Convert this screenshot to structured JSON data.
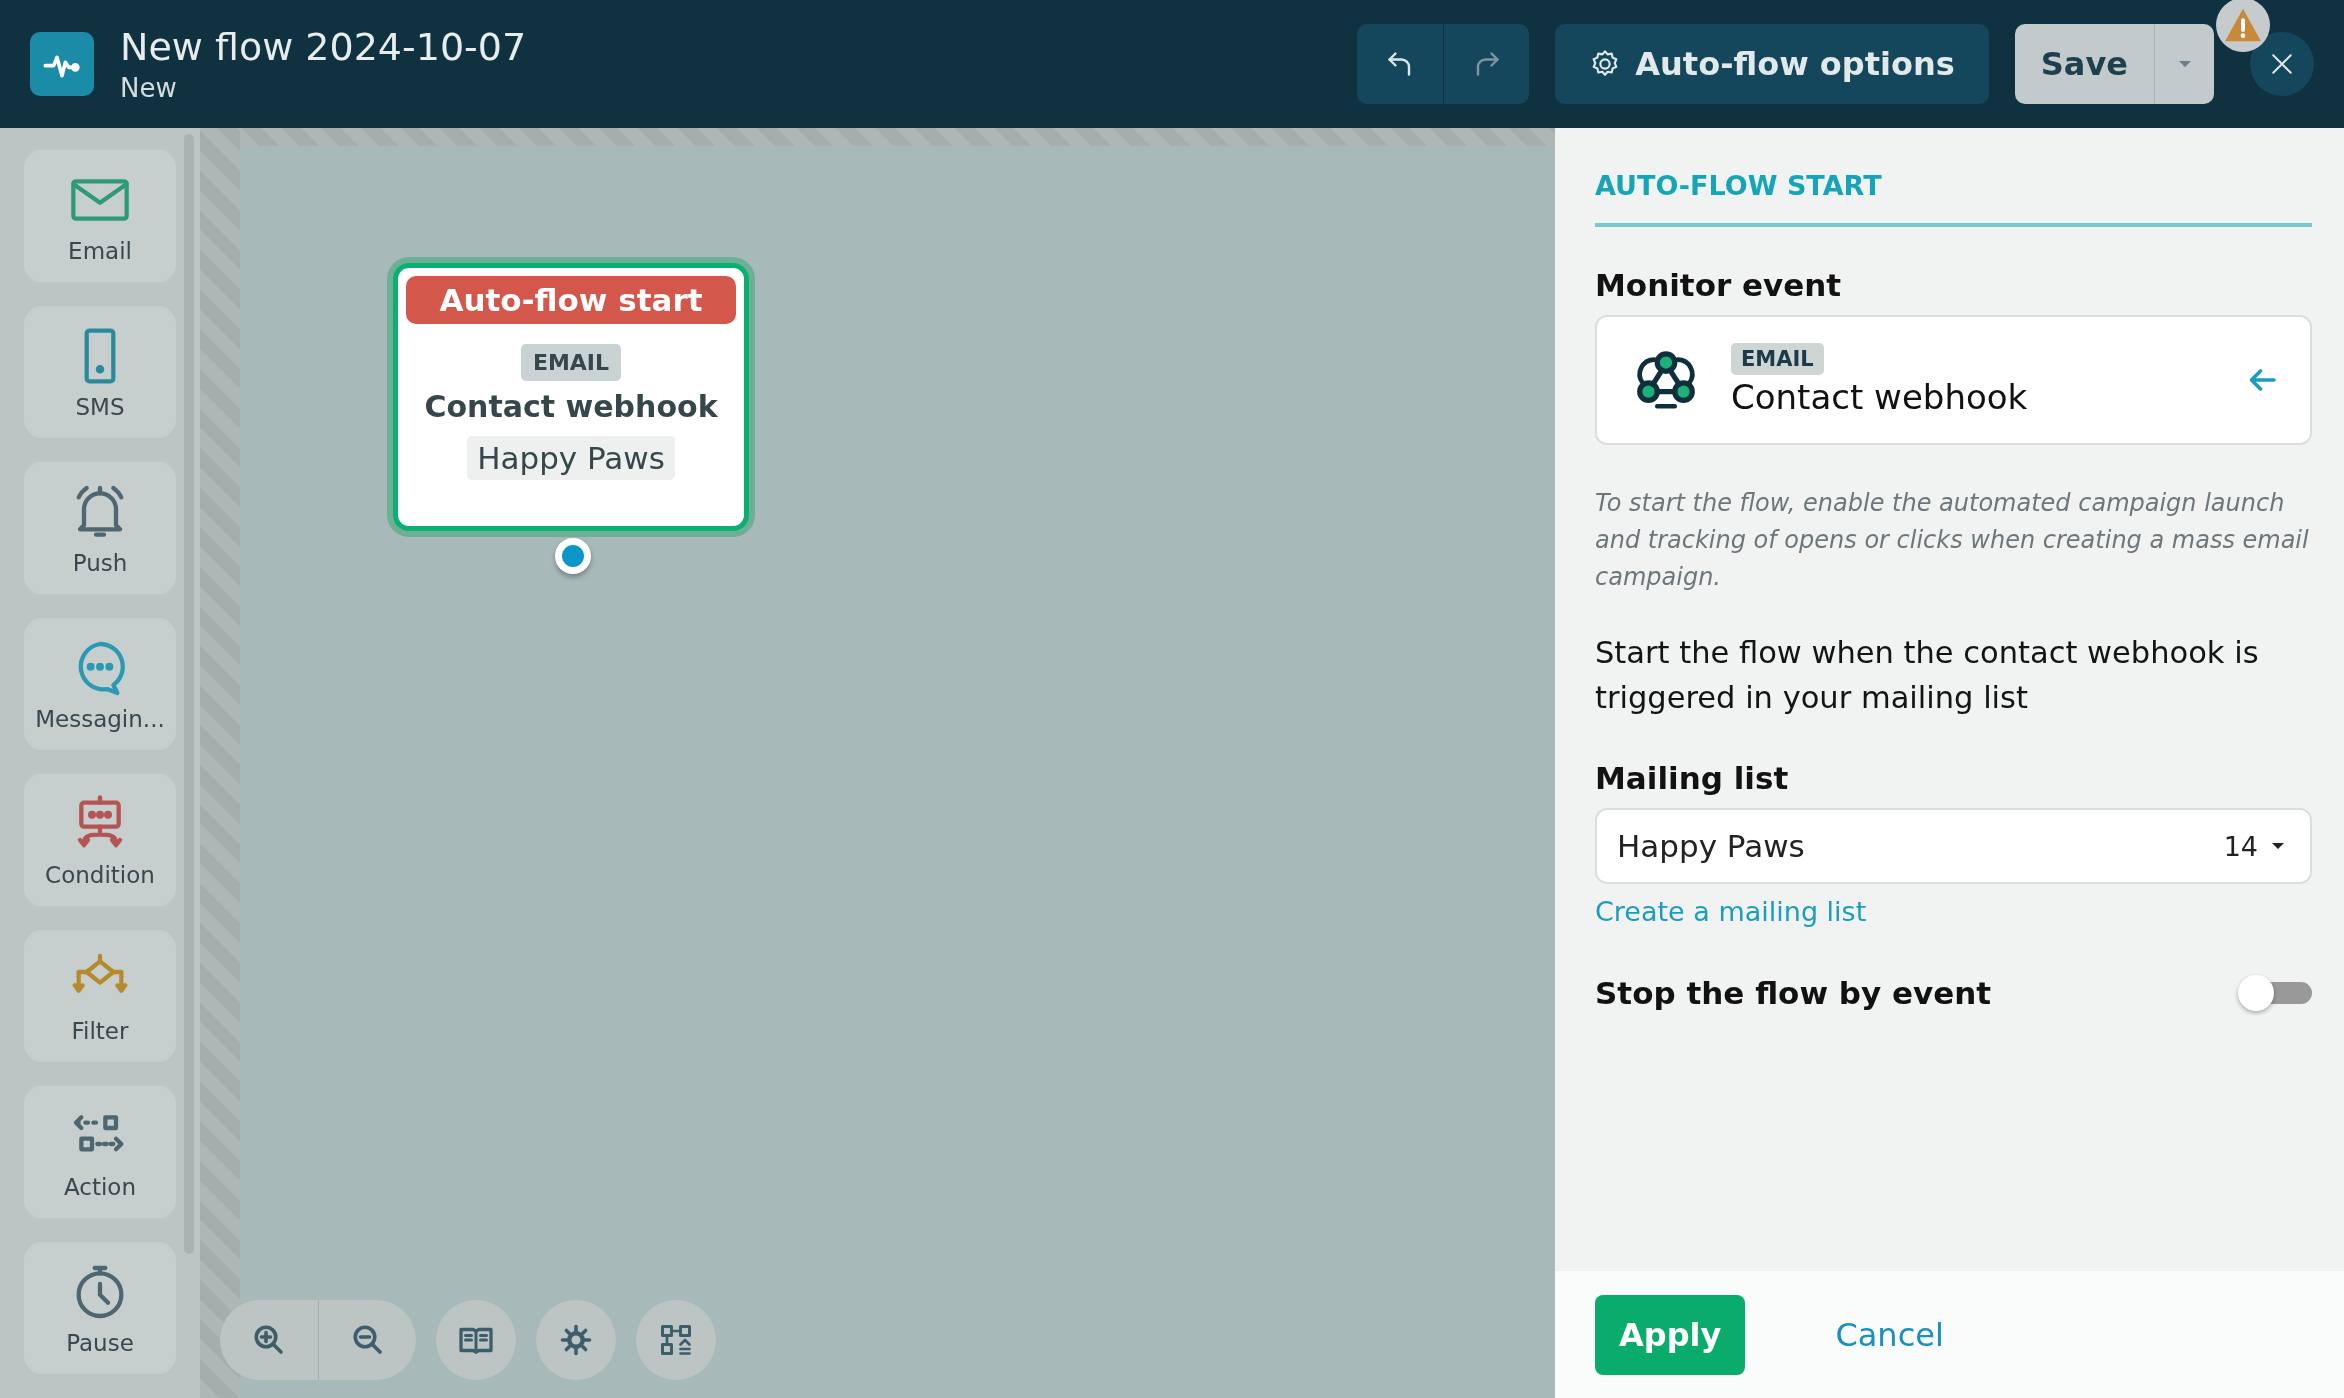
{
  "header": {
    "title": "New flow 2024-10-07",
    "subtitle": "New",
    "options_button": "Auto-flow options",
    "save_button": "Save",
    "warning": true
  },
  "palette": [
    {
      "label": "Email",
      "kind": "email"
    },
    {
      "label": "SMS",
      "kind": "sms"
    },
    {
      "label": "Push",
      "kind": "push"
    },
    {
      "label": "Messagin...",
      "kind": "messaging"
    },
    {
      "label": "Condition",
      "kind": "condition"
    },
    {
      "label": "Filter",
      "kind": "filter"
    },
    {
      "label": "Action",
      "kind": "action"
    },
    {
      "label": "Pause",
      "kind": "pause"
    }
  ],
  "node": {
    "header": "Auto-flow start",
    "tag": "EMAIL",
    "title": "Contact webhook",
    "list": "Happy Paws",
    "selected": true
  },
  "panel": {
    "heading": "AUTO-FLOW START",
    "monitor_label": "Monitor event",
    "event": {
      "tag": "EMAIL",
      "name": "Contact webhook"
    },
    "hint": "To start the flow, enable the automated campaign launch and tracking of opens or clicks when creating a mass email campaign.",
    "description": "Start the flow when the contact webhook is triggered in your mailing list",
    "mailing_list_label": "Mailing list",
    "mailing_list": {
      "value": "Happy Paws",
      "count": "14"
    },
    "create_link": "Create a mailing list",
    "stop_toggle": {
      "label": "Stop the flow by event",
      "on": false
    },
    "apply": "Apply",
    "cancel": "Cancel"
  }
}
